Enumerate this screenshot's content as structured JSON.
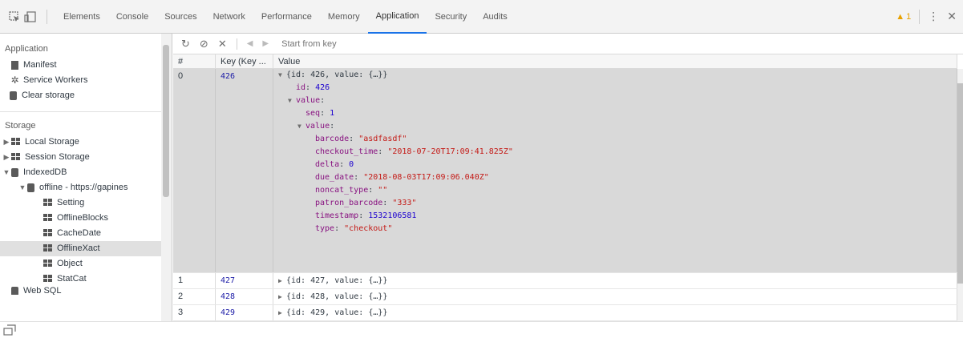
{
  "window": {
    "warnings_count": "1"
  },
  "tabs": [
    "Elements",
    "Console",
    "Sources",
    "Network",
    "Performance",
    "Memory",
    "Application",
    "Security",
    "Audits"
  ],
  "active_tab_index": 6,
  "sidebar": {
    "application_heading": "Application",
    "application_items": [
      "Manifest",
      "Service Workers",
      "Clear storage"
    ],
    "storage_heading": "Storage",
    "storage_items": {
      "local": "Local Storage",
      "session": "Session Storage",
      "indexeddb": "IndexedDB",
      "db": "offline - https://gapines",
      "stores": [
        "Setting",
        "OfflineBlocks",
        "CacheDate",
        "OfflineXact",
        "Object",
        "StatCat"
      ],
      "selected_store": "OfflineXact",
      "websql_partial": "Web SQL"
    }
  },
  "toolbar": {
    "start_placeholder": "Start from key"
  },
  "table": {
    "headers": [
      "#",
      "Key (Key ...",
      "Value"
    ],
    "expanded_row": {
      "index": "0",
      "key": "426",
      "summary": "{id: 426, value: {…}}",
      "lines": [
        {
          "indent": 1,
          "k": "id",
          "v": "426",
          "t": "n"
        },
        {
          "indent": 1,
          "k": "value",
          "v": "",
          "t": "obj"
        },
        {
          "indent": 2,
          "k": "seq",
          "v": "1",
          "t": "n"
        },
        {
          "indent": 2,
          "k": "value",
          "v": "",
          "t": "obj"
        },
        {
          "indent": 3,
          "k": "barcode",
          "v": "\"asdfasdf\"",
          "t": "s"
        },
        {
          "indent": 3,
          "k": "checkout_time",
          "v": "\"2018-07-20T17:09:41.825Z\"",
          "t": "s"
        },
        {
          "indent": 3,
          "k": "delta",
          "v": "0",
          "t": "n"
        },
        {
          "indent": 3,
          "k": "due_date",
          "v": "\"2018-08-03T17:09:06.040Z\"",
          "t": "s"
        },
        {
          "indent": 3,
          "k": "noncat_type",
          "v": "\"\"",
          "t": "s"
        },
        {
          "indent": 3,
          "k": "patron_barcode",
          "v": "\"333\"",
          "t": "s"
        },
        {
          "indent": 3,
          "k": "timestamp",
          "v": "1532106581",
          "t": "n"
        },
        {
          "indent": 3,
          "k": "type",
          "v": "\"checkout\"",
          "t": "s"
        }
      ]
    },
    "rows": [
      {
        "index": "1",
        "key": "427",
        "value": "{id: 427, value: {…}}"
      },
      {
        "index": "2",
        "key": "428",
        "value": "{id: 428, value: {…}}"
      },
      {
        "index": "3",
        "key": "429",
        "value": "{id: 429, value: {…}}"
      }
    ]
  }
}
